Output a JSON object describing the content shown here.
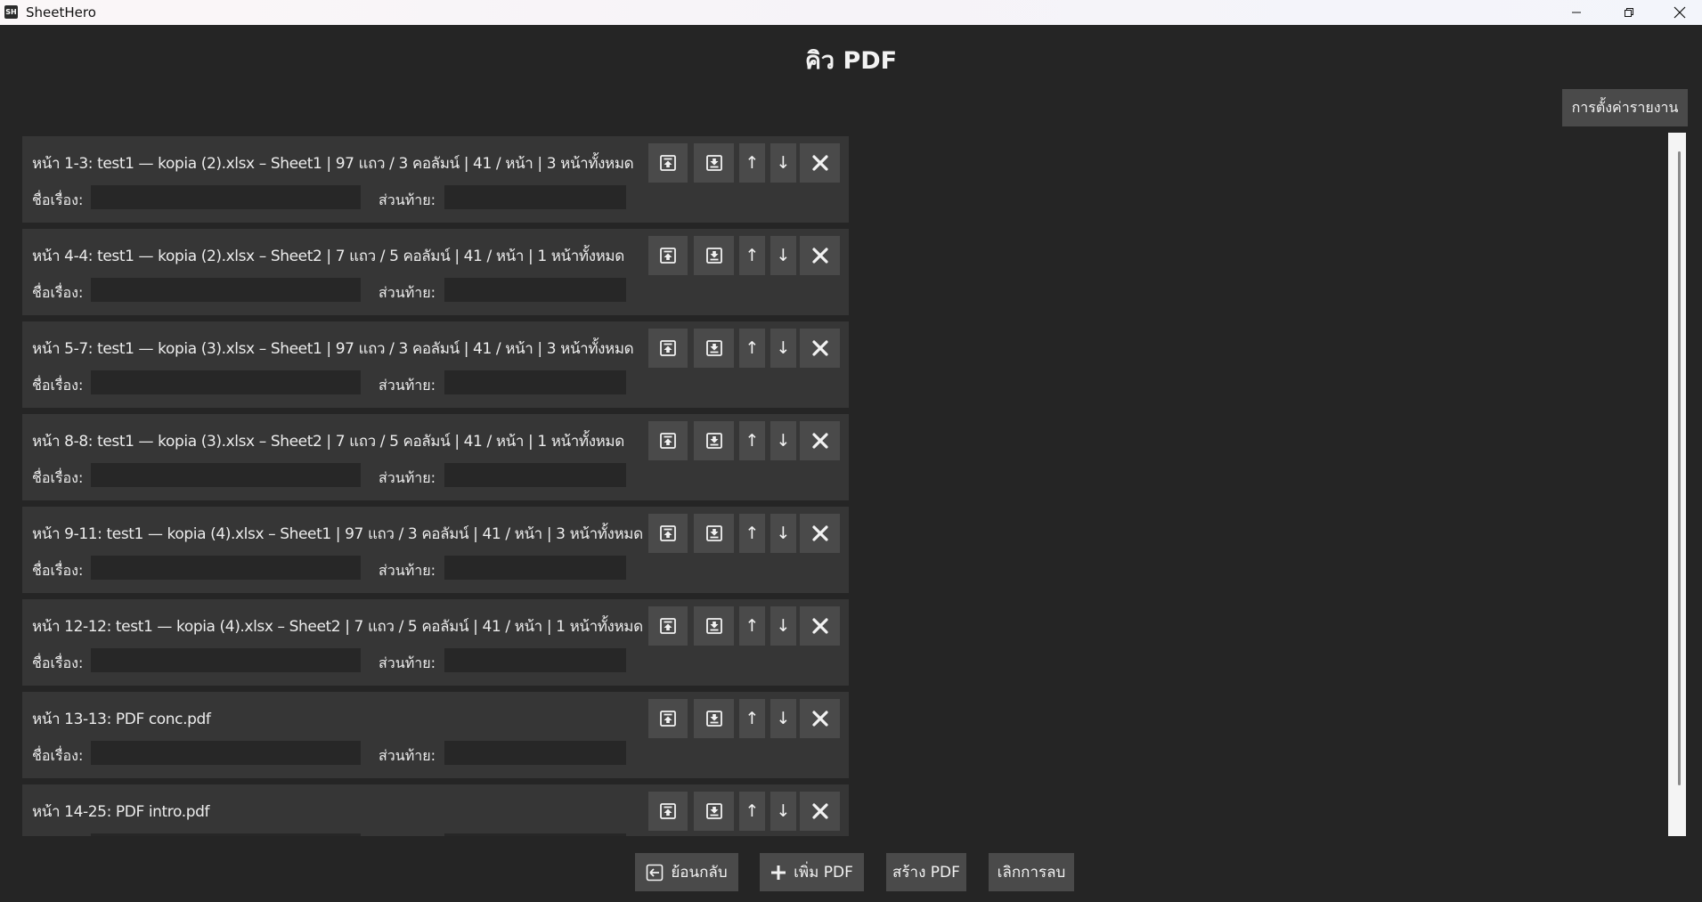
{
  "window": {
    "app_icon_text": "SH",
    "title": "SheetHero",
    "minimize_icon": "minimize-icon",
    "maximize_icon": "restore-icon",
    "close_icon": "close-icon"
  },
  "page": {
    "title": "คิว PDF",
    "report_settings_label": "การตั้งค่ารายงาน"
  },
  "field_labels": {
    "title": "ชื่อเรื่อง:",
    "footer": "ส่วนท้าย:"
  },
  "item_buttons": {
    "move_top_icon": "move-to-top-icon",
    "move_bottom_icon": "move-to-bottom-icon",
    "up_label": "↑",
    "down_label": "↓",
    "remove_icon": "remove-icon"
  },
  "queue": [
    {
      "label": "หน้า 1-3: test1 — kopia (2).xlsx – Sheet1 | 97 แถว / 3 คอลัมน์ | 41 / หน้า | 3 หน้าทั้งหมด",
      "title_value": "",
      "footer_value": ""
    },
    {
      "label": "หน้า 4-4: test1 — kopia (2).xlsx – Sheet2 | 7 แถว / 5 คอลัมน์ | 41 / หน้า | 1 หน้าทั้งหมด",
      "title_value": "",
      "footer_value": ""
    },
    {
      "label": "หน้า 5-7: test1 — kopia (3).xlsx – Sheet1 | 97 แถว / 3 คอลัมน์ | 41 / หน้า | 3 หน้าทั้งหมด",
      "title_value": "",
      "footer_value": ""
    },
    {
      "label": "หน้า 8-8: test1 — kopia (3).xlsx – Sheet2 | 7 แถว / 5 คอลัมน์ | 41 / หน้า | 1 หน้าทั้งหมด",
      "title_value": "",
      "footer_value": ""
    },
    {
      "label": "หน้า 9-11: test1 — kopia (4).xlsx – Sheet1 | 97 แถว / 3 คอลัมน์ | 41 / หน้า | 3 หน้าทั้งหมด",
      "title_value": "",
      "footer_value": ""
    },
    {
      "label": "หน้า 12-12: test1 — kopia (4).xlsx – Sheet2 | 7 แถว / 5 คอลัมน์ | 41 / หน้า | 1 หน้าทั้งหมด",
      "title_value": "",
      "footer_value": ""
    },
    {
      "label": "หน้า 13-13: PDF conc.pdf",
      "title_value": "",
      "footer_value": ""
    },
    {
      "label": "หน้า 14-25: PDF intro.pdf",
      "title_value": "",
      "footer_value": ""
    }
  ],
  "footer_buttons": {
    "back_label": "ย้อนกลับ",
    "back_icon": "back-arrow-icon",
    "add_label": "เพิ่ม PDF",
    "add_icon": "plus-icon",
    "create_label": "สร้าง PDF",
    "cancel_label": "เลิกการลบ"
  }
}
